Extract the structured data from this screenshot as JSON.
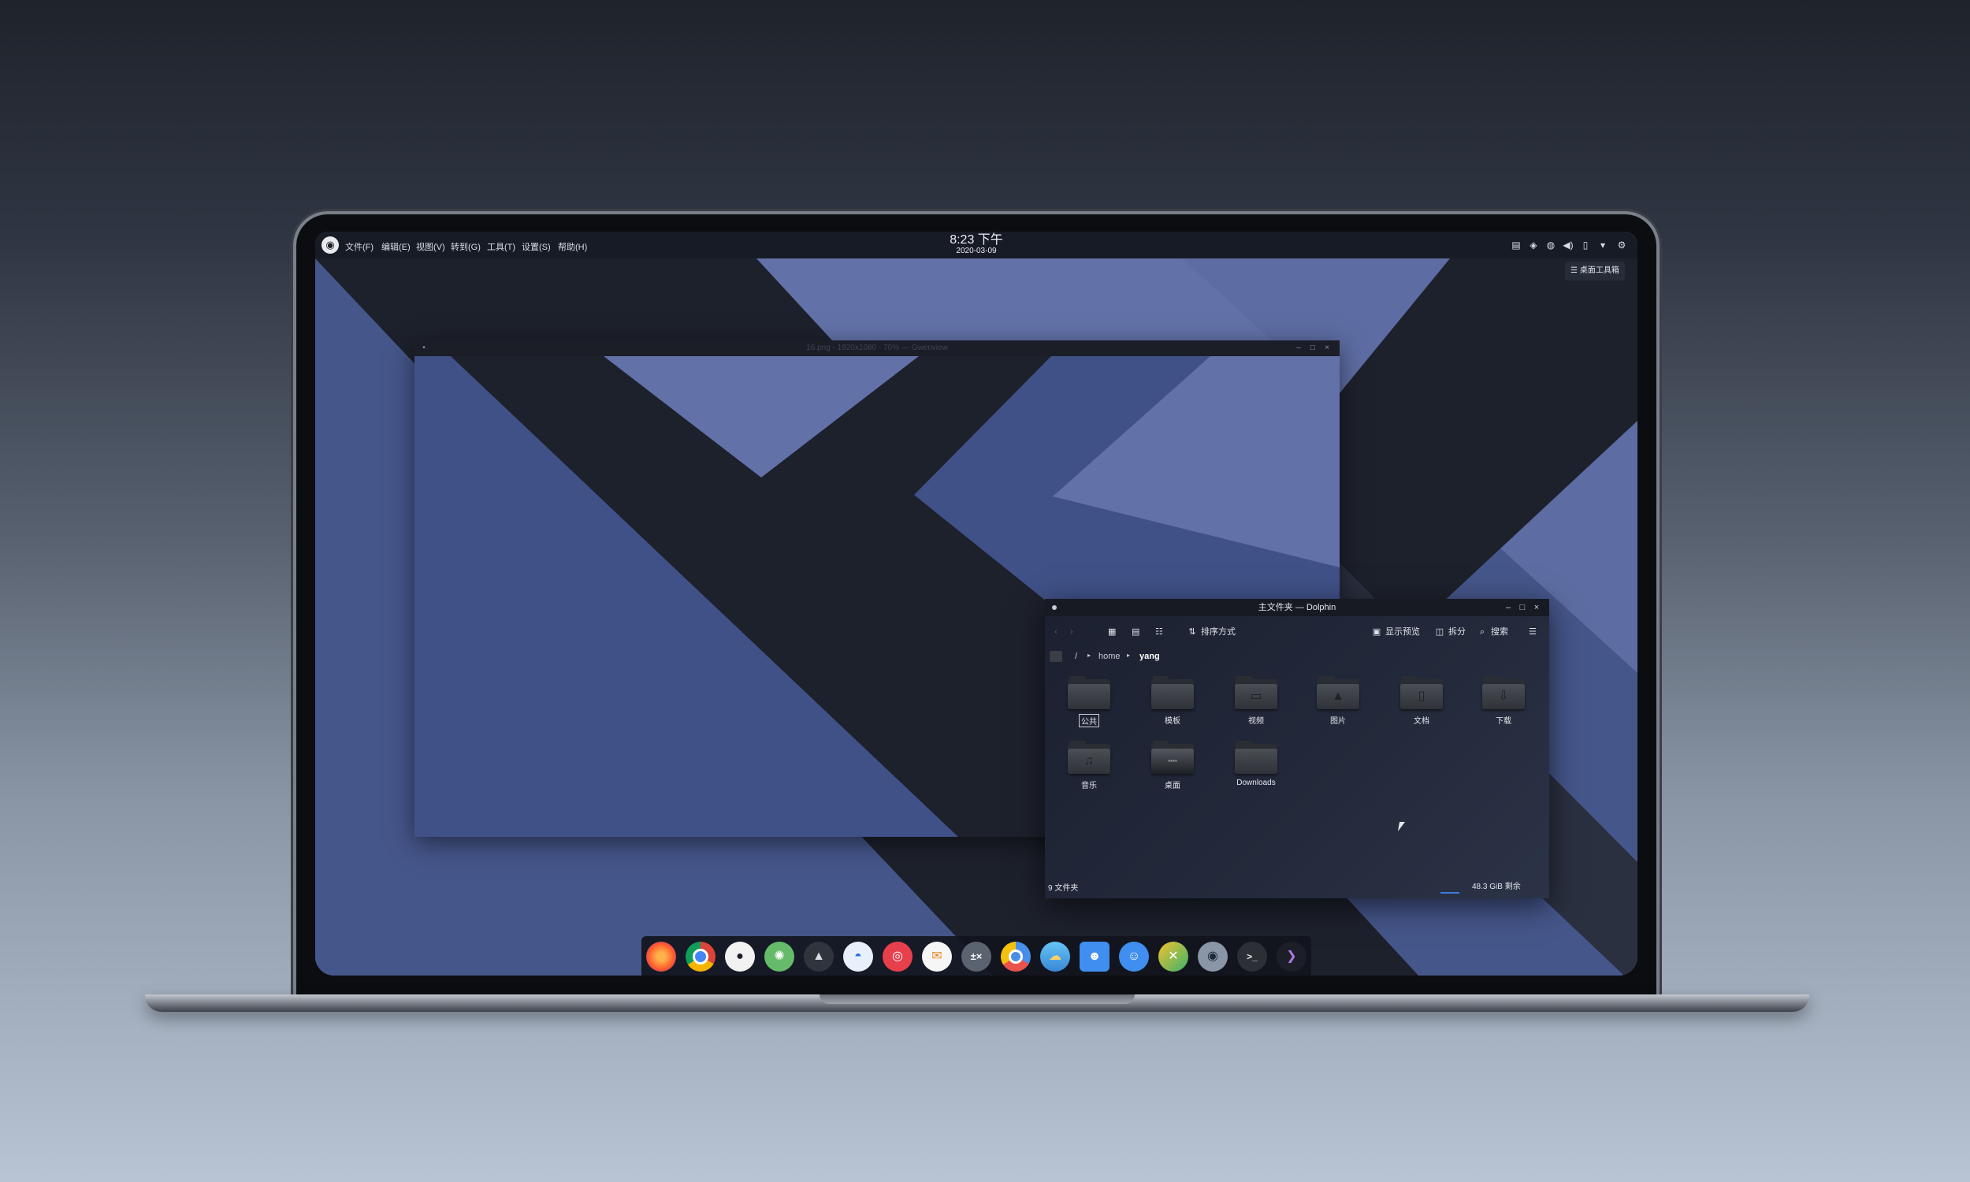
{
  "topbar": {
    "menu": [
      "文件(F)",
      "编辑(E)",
      "视图(V)",
      "转到(G)",
      "工具(T)",
      "设置(S)",
      "帮助(H)"
    ],
    "clock_time": "8:23 下午",
    "clock_date": "2020-03-09",
    "logo_icon": "steam-icon",
    "tray_icons": [
      "keyboard-icon",
      "shield-icon",
      "network-icon",
      "volume-icon",
      "battery-icon",
      "expand-arrow-icon",
      "settings-icon"
    ]
  },
  "desktop": {
    "toolbox_label": "桌面工具箱"
  },
  "gwenview": {
    "title": "16.png - 1920x1080 - 70% — Gwenview"
  },
  "dolphin": {
    "title": "主文件夹 — Dolphin",
    "toolbar": {
      "sort_label": "排序方式",
      "preview_label": "显示预览",
      "split_label": "拆分",
      "search_label": "搜索"
    },
    "breadcrumb": {
      "root": "/",
      "home": "home",
      "current": "yang"
    },
    "folders": [
      {
        "label": "公共",
        "icon": "share-folder-icon"
      },
      {
        "label": "模板",
        "icon": "template-folder-icon"
      },
      {
        "label": "视频",
        "icon": "video-folder-icon"
      },
      {
        "label": "图片",
        "icon": "picture-folder-icon"
      },
      {
        "label": "文档",
        "icon": "document-folder-icon"
      },
      {
        "label": "下载",
        "icon": "download-folder-icon"
      },
      {
        "label": "音乐",
        "icon": "music-folder-icon"
      },
      {
        "label": "桌面",
        "icon": "desktop-folder-icon"
      },
      {
        "label": "Downloads",
        "icon": "folder-icon"
      }
    ],
    "status_left": "9 文件夹",
    "status_right": "48.3 GiB 剩余"
  },
  "dock": {
    "apps": [
      {
        "name": "firefox-icon",
        "color": "#ff7139"
      },
      {
        "name": "chrome-icon",
        "color": "#4285f4"
      },
      {
        "name": "github-icon",
        "color": "#f2f2f2"
      },
      {
        "name": "atom-icon",
        "color": "#66bb6a"
      },
      {
        "name": "inkscape-icon",
        "color": "#30343d"
      },
      {
        "name": "qq-icon",
        "color": "#e8f1fb"
      },
      {
        "name": "netease-music-icon",
        "color": "#e7404c"
      },
      {
        "name": "mail-icon",
        "color": "#f6f6f6"
      },
      {
        "name": "calculator-icon",
        "color": "#5b6270"
      },
      {
        "name": "chromium-icon",
        "color": "#4a8fe7"
      },
      {
        "name": "weather-icon",
        "color": "#4fb0e8"
      },
      {
        "name": "finder-icon",
        "color": "#3f8ef0"
      },
      {
        "name": "dolphin-icon",
        "color": "#3f8ef0"
      },
      {
        "name": "cross-app-icon",
        "color": "#3bb36a"
      },
      {
        "name": "system-monitor-icon",
        "color": "#8a96a6"
      },
      {
        "name": "terminal-icon",
        "color": "#2c2f36"
      },
      {
        "name": "kdevelop-icon",
        "color": "#1c1f27"
      }
    ]
  },
  "colors": {
    "wallpaper_blue": "#4a5b8e",
    "wallpaper_light": "#6272a8",
    "wallpaper_dark": "#1d212c",
    "panel_bg": "#161921"
  }
}
